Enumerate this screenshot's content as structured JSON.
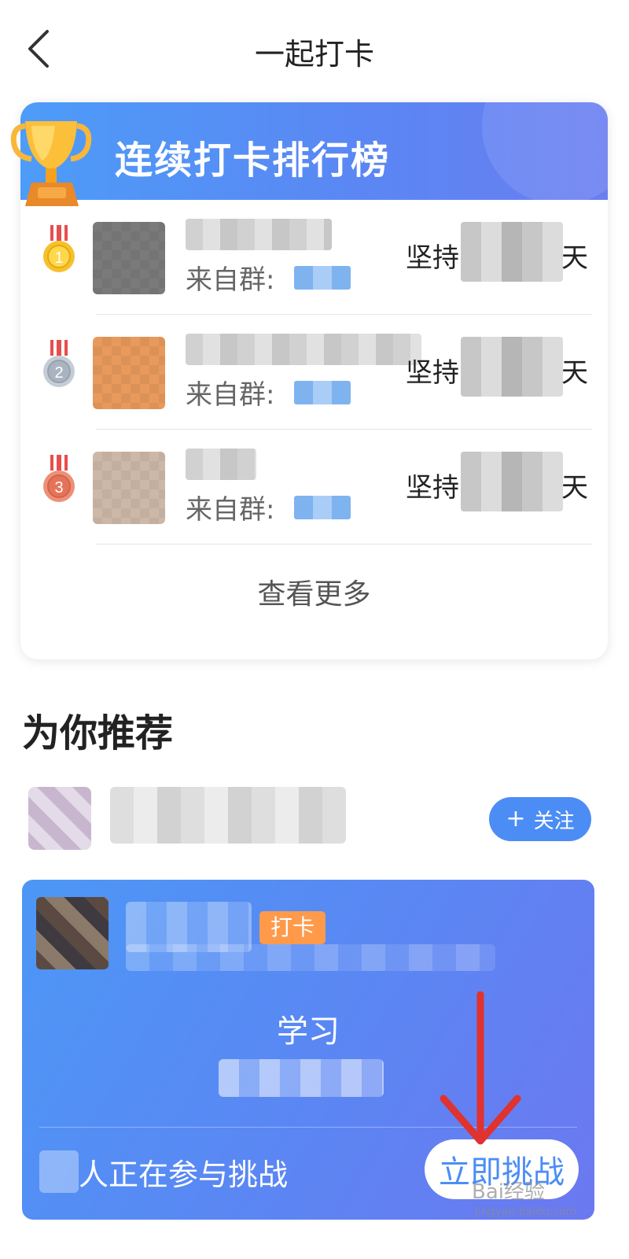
{
  "header": {
    "title": "一起打卡"
  },
  "ranking": {
    "title": "连续打卡排行榜",
    "from_label": "来自群:",
    "persist_label": "坚持",
    "days_unit": "天",
    "entries": [
      {
        "rank": "1"
      },
      {
        "rank": "2"
      },
      {
        "rank": "3"
      }
    ],
    "see_more": "查看更多"
  },
  "recommend": {
    "title": "为你推荐",
    "follow_icon": "+",
    "follow_label": "关注",
    "challenge": {
      "tag": "打卡",
      "main_text": "学习",
      "participants_label": "人正在参与挑战",
      "join_label": "立即挑战"
    }
  },
  "watermark": {
    "text": "Bai经验",
    "url": "jingyan.baidu.com"
  },
  "colors": {
    "accent": "#4c8df5",
    "tag": "#ff9a4a",
    "gold": "#f6c12b",
    "silver": "#b9c2cc",
    "bronze": "#e9826a",
    "annotation_arrow": "#e0322e"
  }
}
